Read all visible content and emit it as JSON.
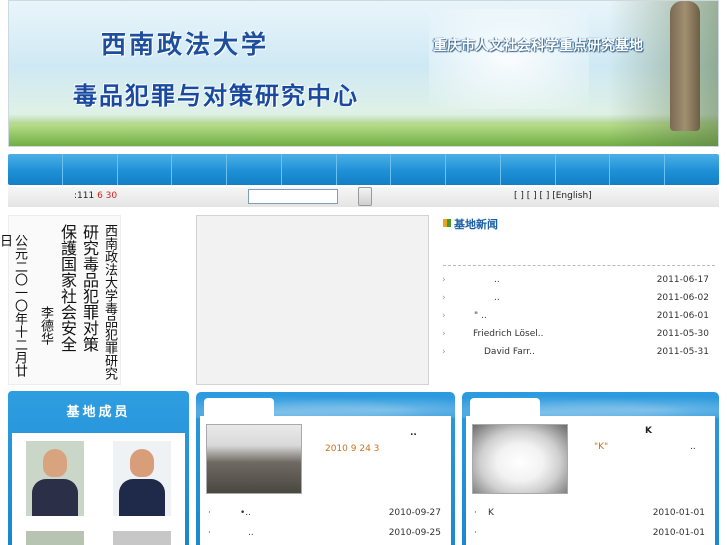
{
  "banner": {
    "university": "西南政法大学",
    "center": "毒品犯罪与对策研究中心",
    "base": "重庆市人文社会科学重点研究基地"
  },
  "nav": {
    "items": [
      "",
      "",
      "",
      "",
      "",
      "",
      "",
      "",
      "",
      "",
      "",
      "",
      ""
    ]
  },
  "infobar": {
    "visits_prefix": ":111",
    "visits_red": " 6 30",
    "search_placeholder": "",
    "lang_links": "[ ] [ ] [ ] [English]"
  },
  "calligraphy": {
    "columns": [
      "西南政法大学毒品犯罪研究",
      "研究毒品犯罪对策",
      "保護国家社会安全",
      "李德华",
      "公元二〇一〇年十二月廿日"
    ]
  },
  "news": {
    "title": "基地新闻",
    "items": [
      {
        "text": "..",
        "date": "2011-06-17"
      },
      {
        "text": "..",
        "date": "2011-06-02"
      },
      {
        "text": "\" ..",
        "date": "2011-06-01"
      },
      {
        "text": "Friedrich Lösel..",
        "date": "2011-05-30"
      },
      {
        "text": "David Farr..",
        "date": "2011-05-31"
      }
    ]
  },
  "members": {
    "title": "基地成员"
  },
  "panel1": {
    "headline": "..",
    "subline": "2010 9 24 3",
    "rows": [
      {
        "text": "•..",
        "date": "2010-09-27"
      },
      {
        "text": "..",
        "date": "2010-09-25"
      }
    ]
  },
  "panel2": {
    "headline": "K",
    "subline": "\"K\"",
    "subline_tail": "..",
    "rows": [
      {
        "text": "K",
        "date": "2010-01-01"
      },
      {
        "text": "",
        "date": "2010-01-01"
      }
    ]
  },
  "colors": {
    "nav": "#1e8fd6",
    "accent_blue": "#1b5fa8",
    "visits_red": "#d81b1b",
    "panel_blue": "#1b88d0",
    "date_orange": "#c8721c"
  }
}
